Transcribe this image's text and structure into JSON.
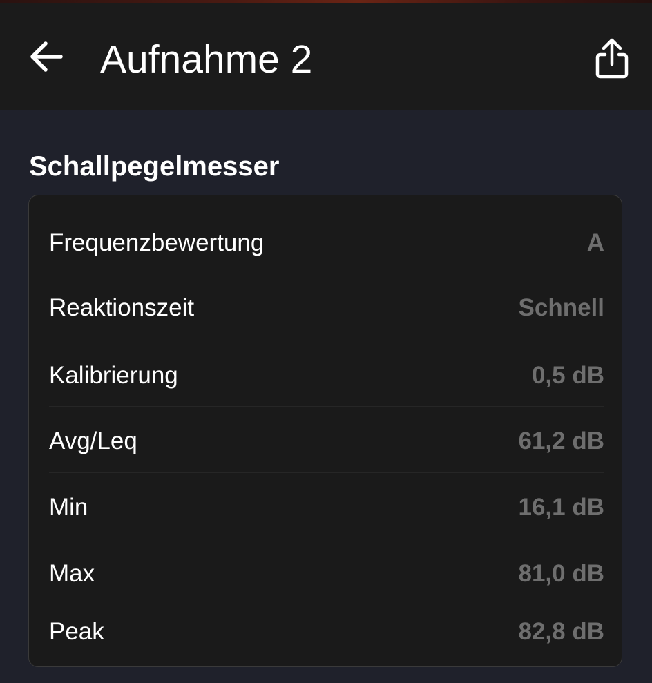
{
  "header": {
    "title": "Aufnahme 2",
    "back_icon": "arrow-left-icon",
    "share_icon": "share-icon"
  },
  "section": {
    "title": "Schallpegelmesser"
  },
  "settings": [
    {
      "label": "Frequenzbewertung",
      "value": "A"
    },
    {
      "label": "Reaktionszeit",
      "value": "Schnell"
    },
    {
      "label": "Kalibrierung",
      "value": "0,5 dB"
    },
    {
      "label": "Avg/Leq",
      "value": "61,2 dB"
    },
    {
      "label": "Min",
      "value": "16,1 dB"
    },
    {
      "label": "Max",
      "value": "81,0 dB"
    },
    {
      "label": "Peak",
      "value": "82,8 dB"
    }
  ],
  "colors": {
    "app_bar": "#1b1b1b",
    "background": "#1f212b",
    "card": "#1a1a1a",
    "text_primary": "#ffffff",
    "text_value": "#6e6e6e"
  }
}
